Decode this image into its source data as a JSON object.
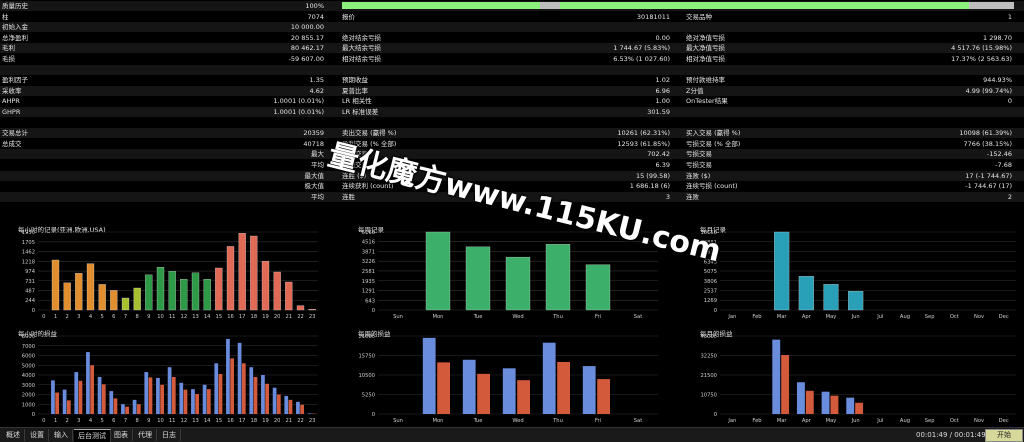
{
  "stats": {
    "rows": [
      [
        "质量历史",
        "100%",
        "",
        "",
        "",
        ""
      ],
      [
        "柱",
        "7074",
        "报价",
        "30181011",
        "交易品种",
        "1"
      ],
      [
        "初始入金",
        "10 000.00",
        "",
        "",
        "",
        ""
      ],
      [
        "总净盈利",
        "20 855.17",
        "绝对结余亏损",
        "0.00",
        "绝对净值亏损",
        "1 298.70"
      ],
      [
        "毛利",
        "80 462.17",
        "最大结余亏损",
        "1 744.67 (5.83%)",
        "最大净值亏损",
        "4 517.76 (15.98%)"
      ],
      [
        "毛损",
        "-59 607.00",
        "相对结余亏损",
        "6.53% (1 027.60)",
        "相对净值亏损",
        "17.37% (2 563.63)"
      ],
      [
        "",
        "",
        "",
        "",
        "",
        ""
      ],
      [
        "盈利因子",
        "1.35",
        "预期收益",
        "1.02",
        "预付款维持率",
        "944.93%"
      ],
      [
        "采收率",
        "4.62",
        "夏普比率",
        "6.96",
        "Z分值",
        "4.99 (99.74%)"
      ],
      [
        "AHPR",
        "1.0001 (0.01%)",
        "LR 相关性",
        "1.00",
        "OnTester结果",
        "0"
      ],
      [
        "GHPR",
        "1.0001 (0.01%)",
        "LR 标准误差",
        "301.59",
        "",
        ""
      ],
      [
        "",
        "",
        "",
        "",
        "",
        ""
      ],
      [
        "交易总计",
        "20359",
        "卖出交易 (赢得 %)",
        "10261 (62.31%)",
        "买入交易 (赢得 %)",
        "10098 (61.39%)"
      ],
      [
        "总成交",
        "40718",
        "盈利交易 (% 全部)",
        "12593 (61.85%)",
        "亏损交易 (% 全部)",
        "7766 (38.15%)"
      ],
      [
        "",
        "最大",
        "获利交易",
        "702.42",
        "亏损交易",
        "-152.46"
      ],
      [
        "",
        "平均",
        "获利交易",
        "6.39",
        "亏损交易",
        "-7.68"
      ],
      [
        "",
        "最大值",
        "连胜 ($)",
        "15 (99.58)",
        "连败 ($)",
        "17 (-1 744.67)"
      ],
      [
        "",
        "极大值",
        "连续获利 (count)",
        "1 686.18 (6)",
        "连续亏损 (count)",
        "-1 744.67 (17)"
      ],
      [
        "",
        "平均",
        "连胜",
        "3",
        "连败",
        "2"
      ]
    ]
  },
  "watermark": "量化魔方www.115KU.com",
  "charts": [
    {
      "title": "每小时的记录(亚洲,欧洲,USA)",
      "chart_data": {
        "type": "bar",
        "categories": [
          "0",
          "1",
          "2",
          "3",
          "4",
          "5",
          "6",
          "7",
          "8",
          "9",
          "10",
          "11",
          "12",
          "13",
          "14",
          "15",
          "16",
          "17",
          "18",
          "19",
          "20",
          "21",
          "22",
          "23"
        ],
        "values": [
          0,
          1250,
          680,
          920,
          1160,
          640,
          490,
          300,
          550,
          880,
          1070,
          970,
          770,
          930,
          770,
          1050,
          1590,
          1920,
          1850,
          1220,
          950,
          700,
          110,
          20
        ],
        "series_colors": [
          "#e08e2e",
          "#e08e2e",
          "#e08e2e",
          "#e08e2e",
          "#e08e2e",
          "#e08e2e",
          "#e08e2e",
          "#a8bf32",
          "#a8bf32",
          "#2e9a48",
          "#2e9a48",
          "#2e9a48",
          "#2e9a48",
          "#2e9a48",
          "#2e9a48",
          "#e06a55",
          "#e06a55",
          "#e06a55",
          "#e06a55",
          "#e06a55",
          "#e06a55",
          "#e06a55",
          "#e06a55",
          "#e06a55"
        ],
        "yticks": [
          "0",
          "244",
          "487",
          "731",
          "974",
          "1218",
          "1462",
          "1705",
          "1950"
        ],
        "ylim": [
          0,
          1950
        ]
      }
    },
    {
      "title": "每周记录",
      "chart_data": {
        "type": "bar",
        "categories": [
          "Sun",
          "Mon",
          "Tue",
          "Wed",
          "Thu",
          "Fri",
          "Sat"
        ],
        "values": [
          0,
          5160,
          4180,
          3500,
          4350,
          3000,
          0
        ],
        "series_colors": [
          "#3cb06a"
        ],
        "yticks": [
          "0",
          "643",
          "1291",
          "1935",
          "2581",
          "3226",
          "3871",
          "4516",
          "5160"
        ],
        "ylim": [
          0,
          5160
        ]
      }
    },
    {
      "title": "每月记录",
      "chart_data": {
        "type": "bar",
        "categories": [
          "Jan",
          "Feb",
          "Mar",
          "Apr",
          "May",
          "Jun",
          "Jul",
          "Aug",
          "Sep",
          "Oct",
          "Nov",
          "Dec"
        ],
        "values": [
          0,
          0,
          10150,
          4390,
          3340,
          2450,
          0,
          0,
          0,
          0,
          0,
          0
        ],
        "series_colors": [
          "#2aa0b8"
        ],
        "yticks": [
          "0",
          "1269",
          "2537",
          "3806",
          "5075",
          "6343",
          "7612",
          "8881",
          "10150"
        ],
        "ylim": [
          0,
          10150
        ]
      }
    },
    {
      "title": "每小时的损益",
      "chart_data": {
        "type": "bar",
        "categories": [
          "0",
          "1",
          "2",
          "3",
          "4",
          "5",
          "6",
          "7",
          "8",
          "9",
          "10",
          "11",
          "12",
          "13",
          "14",
          "15",
          "16",
          "17",
          "18",
          "19",
          "20",
          "21",
          "22",
          "23"
        ],
        "series": [
          {
            "values": [
              0,
              3450,
              2500,
              4300,
              6350,
              3800,
              2350,
              1000,
              1450,
              4300,
              3700,
              4800,
              3200,
              2550,
              3000,
              5200,
              7700,
              7300,
              4800,
              4000,
              2700,
              1850,
              1250,
              60
            ]
          },
          {
            "values": [
              0,
              2200,
              1400,
              3400,
              5000,
              3050,
              1600,
              750,
              1000,
              3750,
              3000,
              3800,
              2500,
              2050,
              2550,
              4100,
              5700,
              5200,
              3800,
              3100,
              2000,
              1450,
              950,
              40
            ]
          }
        ],
        "series_colors": [
          "#6a8cdc",
          "#d45a3c"
        ],
        "yticks": [
          "0",
          "1000",
          "2000",
          "3000",
          "4000",
          "5000",
          "6000",
          "7000",
          "8000"
        ],
        "ylim": [
          0,
          8000
        ]
      }
    },
    {
      "title": "每周的损益",
      "chart_data": {
        "type": "bar",
        "categories": [
          "Sun",
          "Mon",
          "Tue",
          "Wed",
          "Thu",
          "Fri",
          "Sat"
        ],
        "series": [
          {
            "values": [
              0,
              20500,
              14600,
              12300,
              19200,
              12900,
              0
            ]
          },
          {
            "values": [
              0,
              13900,
              10800,
              9100,
              14000,
              9400,
              0
            ]
          }
        ],
        "series_colors": [
          "#6a8cdc",
          "#d45a3c"
        ],
        "yticks": [
          "0",
          "5250",
          "10500",
          "15750",
          "21000"
        ],
        "ylim": [
          0,
          21000
        ]
      }
    },
    {
      "title": "每月的损益",
      "chart_data": {
        "type": "bar",
        "categories": [
          "Jan",
          "Feb",
          "Mar",
          "Apr",
          "May",
          "Jun",
          "Jul",
          "Aug",
          "Sep",
          "Oct",
          "Nov",
          "Dec"
        ],
        "series": [
          {
            "values": [
              0,
              0,
              41000,
              17500,
              12300,
              9000,
              0,
              0,
              0,
              0,
              0,
              0
            ]
          },
          {
            "values": [
              0,
              0,
              32500,
              12800,
              10100,
              6200,
              0,
              0,
              0,
              0,
              0,
              0
            ]
          }
        ],
        "series_colors": [
          "#6a8cdc",
          "#d45a3c"
        ],
        "yticks": [
          "0",
          "10750",
          "21500",
          "32250",
          "43000"
        ],
        "ylim": [
          0,
          43000
        ]
      }
    }
  ],
  "tabs": [
    "概述",
    "设置",
    "输入",
    "后台测试",
    "图表",
    "代理",
    "日志"
  ],
  "active_tab": "后台测试",
  "timer": "00:01:49 / 00:01:49",
  "start_label": "开始"
}
